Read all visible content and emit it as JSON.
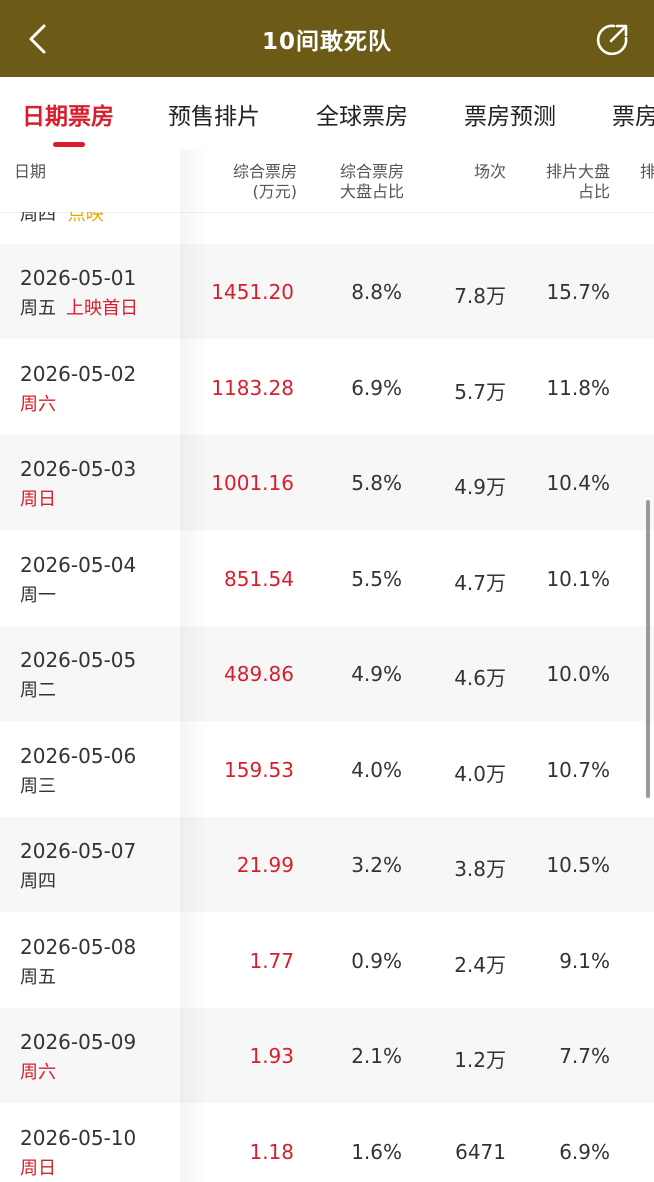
{
  "header": {
    "title": "10间敢死队"
  },
  "tabs": [
    "日期票房",
    "预售排片",
    "全球票房",
    "票房预测",
    "票房"
  ],
  "columns": {
    "date": "日期",
    "box_office": "综合票房\n(万元)",
    "share": "综合票房\n大盘占比",
    "shows": "场次",
    "schedule": "排片大盘\n占比",
    "extra": "排"
  },
  "partial_row": {
    "weekday": "周四",
    "tag": "点映"
  },
  "rows": [
    {
      "date": "2026-05-01",
      "weekday": "周五",
      "tag": "上映首日",
      "box_office": "1451.20",
      "share": "8.8%",
      "shows": "7.8万",
      "schedule": "15.7%"
    },
    {
      "date": "2026-05-02",
      "weekday": "周六",
      "tag": "",
      "box_office": "1183.28",
      "share": "6.9%",
      "shows": "5.7万",
      "schedule": "11.8%"
    },
    {
      "date": "2026-05-03",
      "weekday": "周日",
      "tag": "",
      "box_office": "1001.16",
      "share": "5.8%",
      "shows": "4.9万",
      "schedule": "10.4%"
    },
    {
      "date": "2026-05-04",
      "weekday": "周一",
      "tag": "",
      "box_office": "851.54",
      "share": "5.5%",
      "shows": "4.7万",
      "schedule": "10.1%"
    },
    {
      "date": "2026-05-05",
      "weekday": "周二",
      "tag": "",
      "box_office": "489.86",
      "share": "4.9%",
      "shows": "4.6万",
      "schedule": "10.0%"
    },
    {
      "date": "2026-05-06",
      "weekday": "周三",
      "tag": "",
      "box_office": "159.53",
      "share": "4.0%",
      "shows": "4.0万",
      "schedule": "10.7%"
    },
    {
      "date": "2026-05-07",
      "weekday": "周四",
      "tag": "",
      "box_office": "21.99",
      "share": "3.2%",
      "shows": "3.8万",
      "schedule": "10.5%"
    },
    {
      "date": "2026-05-08",
      "weekday": "周五",
      "tag": "",
      "box_office": "1.77",
      "share": "0.9%",
      "shows": "2.4万",
      "schedule": "9.1%"
    },
    {
      "date": "2026-05-09",
      "weekday": "周六",
      "tag": "",
      "box_office": "1.93",
      "share": "2.1%",
      "shows": "1.2万",
      "schedule": "7.7%"
    },
    {
      "date": "2026-05-10",
      "weekday": "周日",
      "tag": "",
      "box_office": "1.18",
      "share": "1.6%",
      "shows": "6471",
      "schedule": "6.9%"
    }
  ],
  "weekend_days": [
    "周六",
    "周日"
  ],
  "colors": {
    "header_bg": "#6b5b16",
    "accent": "#d81e2c",
    "tag_gold": "#e8a800"
  }
}
